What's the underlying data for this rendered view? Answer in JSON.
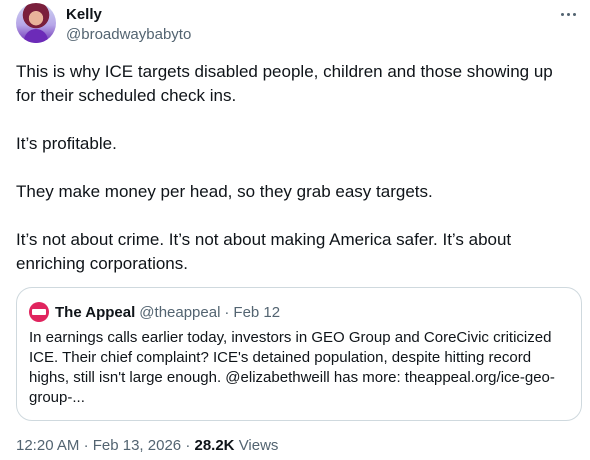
{
  "author": {
    "display_name": "Kelly",
    "handle": "@broadwaybabyto"
  },
  "menu": {
    "icon": "more-horizontal-icon"
  },
  "tweet": {
    "paragraphs": [
      "This is why ICE targets disabled people, children and those showing up for their scheduled check ins.",
      "It’s profitable.",
      "They make money per head, so they grab easy targets.",
      "It’s not about crime. It’s not about making America safer. It’s about enriching corporations."
    ]
  },
  "quote": {
    "display_name": "The Appeal",
    "handle": "@theappeal",
    "separator": "·",
    "date": "Feb 12",
    "avatar_text": "THE APPEAL",
    "avatar_color": "#e0245e",
    "text": "In earnings calls earlier today, investors in GEO Group and CoreCivic criticized ICE. Their chief complaint? ICE's detained population, despite hitting record highs, still isn't large enough. @elizabethweill has more: theappeal.org/ice-geo-group-..."
  },
  "meta": {
    "time": "12:20 AM",
    "separator": "·",
    "date": "Feb 13, 2026",
    "views_count": "28.2K",
    "views_label": "Views"
  },
  "colors": {
    "text": "#0f1419",
    "secondary": "#536471",
    "border": "#cfd9de"
  }
}
